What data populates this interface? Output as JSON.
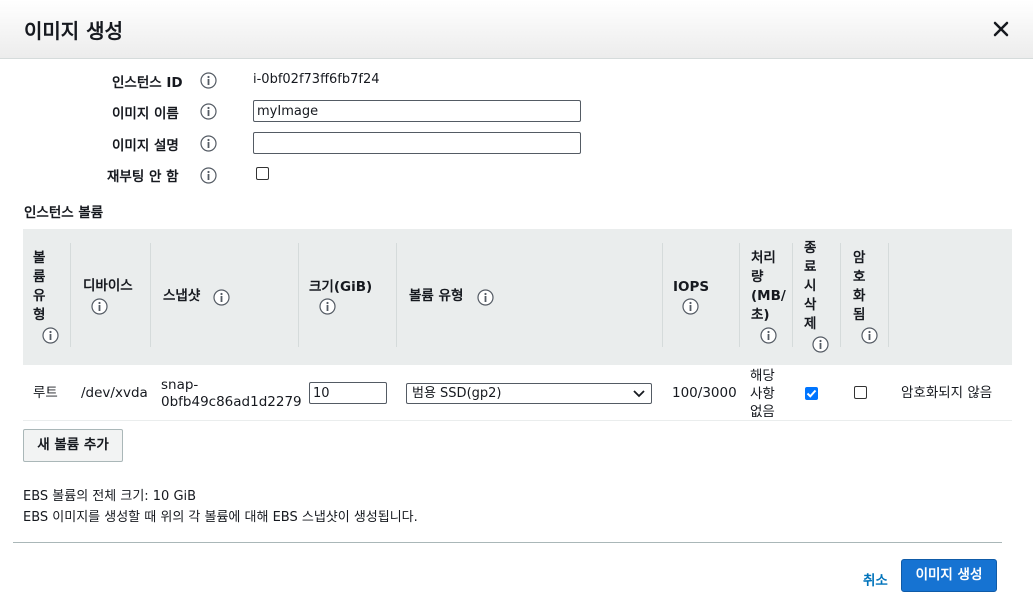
{
  "dialog": {
    "title": "이미지 생성"
  },
  "form": {
    "instance_id_label": "인스턴스 ID",
    "instance_id_value": "i-0bf02f73ff6fb7f24",
    "image_name_label": "이미지 이름",
    "image_name_value": "myImage",
    "image_desc_label": "이미지 설명",
    "image_desc_value": "",
    "no_reboot_label": "재부팅 안 함",
    "no_reboot_checked": false
  },
  "volumes": {
    "section_title": "인스턴스 볼륨",
    "headers": {
      "volume_type": [
        "볼",
        "륨",
        "유",
        "형"
      ],
      "device": "디바이스",
      "snapshot": "스냅샷",
      "size": "크기(GiB)",
      "ebs_type": "볼륨 유형",
      "iops": "IOPS",
      "throughput": [
        "처리",
        "량",
        "(MB/",
        "초)"
      ],
      "delete_on_term": [
        "종",
        "료",
        "시",
        "삭",
        "제"
      ],
      "encrypted": [
        "암",
        "호",
        "화",
        "됨"
      ]
    },
    "rows": [
      {
        "volume_type": "루트",
        "device": "/dev/xvda",
        "snapshot_line1": "snap-",
        "snapshot_line2": "0bfb49c86ad1d2279",
        "size": "10",
        "ebs_type": "범용 SSD(gp2)",
        "iops": "100/3000",
        "throughput": [
          "해당",
          "사항",
          "없음"
        ],
        "delete_on_term": true,
        "encrypted": false,
        "encryption_status": "암호화되지 않음"
      }
    ],
    "add_button": "새 볼륨 추가"
  },
  "notes": {
    "total_size": "EBS 볼륨의 전체 크기: 10 GiB",
    "snapshot_note": "EBS 이미지를 생성할 때 위의 각 볼륨에 대해 EBS 스냅샷이 생성됩니다."
  },
  "footer": {
    "cancel": "취소",
    "create": "이미지 생성"
  },
  "colors": {
    "primary": "#1673d2",
    "link": "#0073bb",
    "header_bg": "#eaeded"
  }
}
